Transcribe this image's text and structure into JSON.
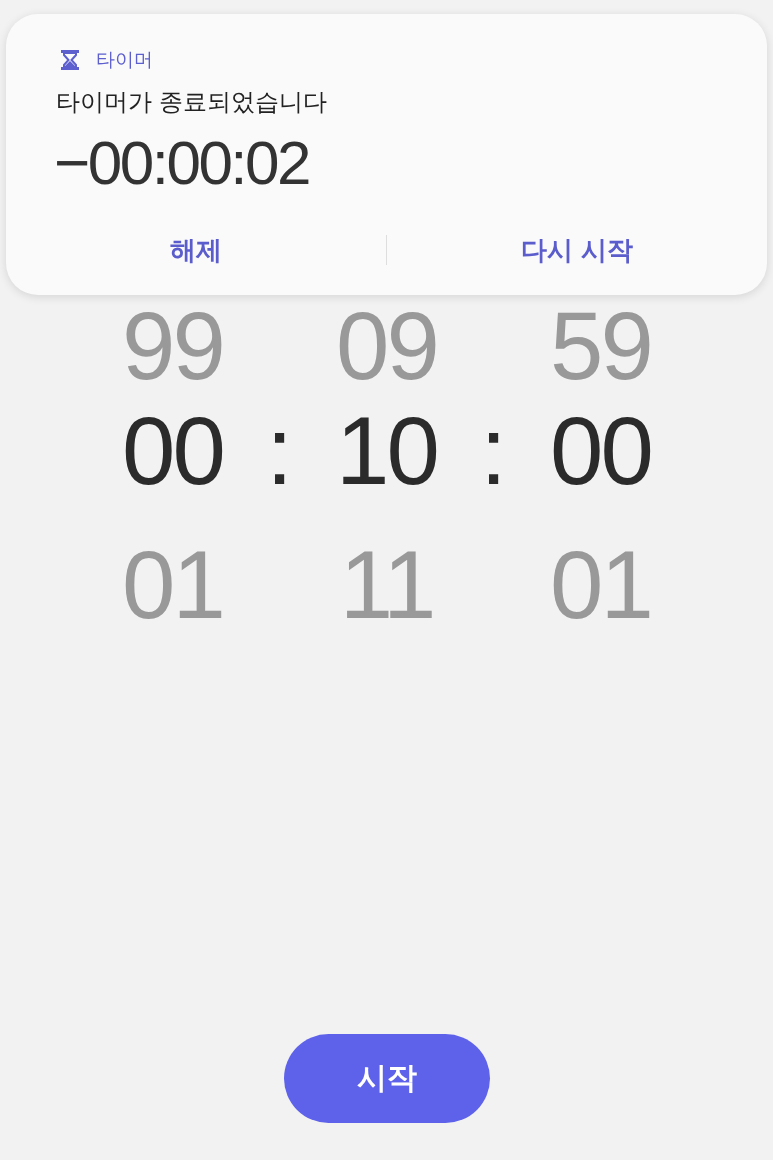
{
  "notification": {
    "app_name": "타이머",
    "message": "타이머가 종료되었습니다",
    "overtime": "−00:00:02",
    "actions": [
      "해제",
      "다시 시작"
    ]
  },
  "picker": {
    "columns": [
      {
        "above": "99",
        "value": "00",
        "below": "01"
      },
      {
        "above": "09",
        "value": "10",
        "below": "11"
      },
      {
        "above": "59",
        "value": "00",
        "below": "01"
      }
    ],
    "separators": [
      ":",
      ":"
    ]
  },
  "start_button": {
    "label": "시작"
  }
}
